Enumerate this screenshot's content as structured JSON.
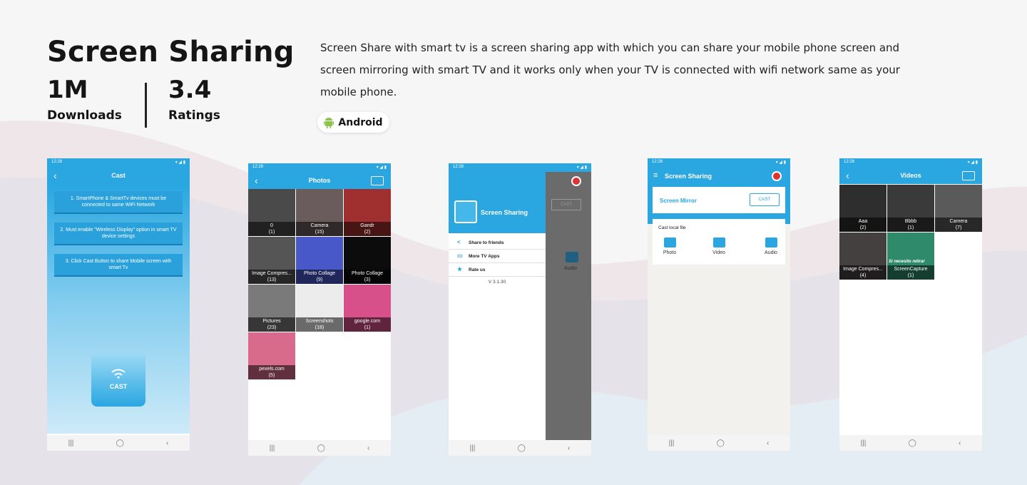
{
  "header": {
    "title": "Screen Sharing",
    "downloads_value": "1M",
    "downloads_label": "Downloads",
    "ratings_value": "3.4",
    "ratings_label": "Ratings",
    "description": "Screen Share with smart tv is a screen sharing app with which you can share your mobile phone screen and screen mirroring with smart TV and it works only when your TV is connected with wifi network same as your mobile phone.",
    "platform": "Android"
  },
  "colors": {
    "accent": "#2aa6e0",
    "background": "#f6f6f6"
  },
  "status_time": "12:28",
  "phone1": {
    "title": "Cast",
    "steps": [
      "1. SmartPhone & SmartTv devices must be connected to same WiFi Network",
      "2. Must enable \"Wireless Display\" option in smart TV device settings",
      "3. Click Cast Button to share Mobile screen with smart Tv"
    ],
    "cast_label": "CAST"
  },
  "phone2": {
    "title": "Photos",
    "albums": [
      {
        "name": "0",
        "count": "(1)",
        "color": "#4a4a4a"
      },
      {
        "name": "Camera",
        "count": "(15)",
        "color": "#6a5c5c"
      },
      {
        "name": "Gandr",
        "count": "(2)",
        "color": "#a03030"
      },
      {
        "name": "Image Compres...",
        "count": "(13)",
        "color": "#555555"
      },
      {
        "name": "Photo Collage",
        "count": "(9)",
        "color": "#4858c8"
      },
      {
        "name": "Photo Collage",
        "count": "(3)",
        "color": "#0c0c0c"
      },
      {
        "name": "Pictures",
        "count": "(23)",
        "color": "#7a7a7a"
      },
      {
        "name": "Screenshots",
        "count": "(18)",
        "color": "#ececec"
      },
      {
        "name": "google.com",
        "count": "(1)",
        "color": "#d8508a"
      },
      {
        "name": "pexels.com",
        "count": "(5)",
        "color": "#d86a8c"
      }
    ]
  },
  "phone3": {
    "app_name": "Screen Sharing",
    "items": [
      "Share to friends",
      "More TV Apps",
      "Rate us"
    ],
    "version": "V 3.1.30",
    "cast_label": "CAST",
    "audio_label": "Audio"
  },
  "phone4": {
    "title": "Screen Sharing",
    "mirror_label": "Screen Mirror",
    "cast_label": "CAST",
    "local_label": "Cast local file",
    "options": [
      "Photo",
      "Video",
      "Audio"
    ]
  },
  "phone5": {
    "title": "Videos",
    "albums": [
      {
        "name": "Aaa",
        "count": "(2)",
        "color": "#2e2e2e"
      },
      {
        "name": "Bbbb",
        "count": "(1)",
        "color": "#3a3a3a"
      },
      {
        "name": "Camera",
        "count": "(7)",
        "color": "#5a5a5a"
      },
      {
        "name": "Image Compres...",
        "count": "(4)",
        "color": "#454040"
      },
      {
        "name": "ScreenCapture",
        "count": "(1)",
        "color": "#2e8a6a",
        "overlay": "Si necesito retirar"
      }
    ]
  }
}
